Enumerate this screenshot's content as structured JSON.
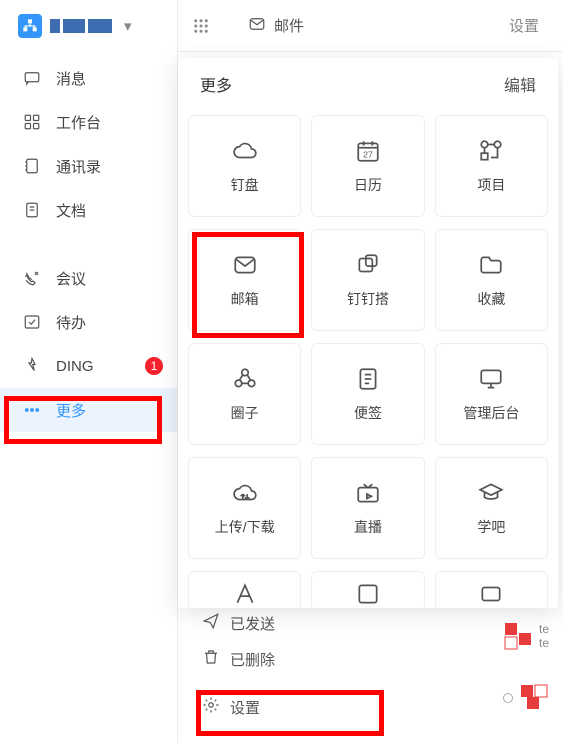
{
  "org": {
    "name_masked": true
  },
  "sidebar": {
    "items": [
      {
        "label": "消息",
        "icon": "chat"
      },
      {
        "label": "工作台",
        "icon": "apps"
      },
      {
        "label": "通讯录",
        "icon": "contacts"
      },
      {
        "label": "文档",
        "icon": "doc"
      }
    ],
    "items2": [
      {
        "label": "会议",
        "icon": "meeting"
      },
      {
        "label": "待办",
        "icon": "todo"
      },
      {
        "label": "DING",
        "icon": "ding",
        "badge": "1"
      }
    ],
    "more_label": "更多"
  },
  "topbar": {
    "mail_label": "邮件",
    "settings_label": "设置"
  },
  "more_panel": {
    "title": "更多",
    "edit": "编辑",
    "tiles": [
      {
        "label": "钉盘",
        "icon": "cloud"
      },
      {
        "label": "日历",
        "icon": "calendar"
      },
      {
        "label": "项目",
        "icon": "project"
      },
      {
        "label": "邮箱",
        "icon": "mail"
      },
      {
        "label": "钉钉搭",
        "icon": "builder"
      },
      {
        "label": "收藏",
        "icon": "folder"
      },
      {
        "label": "圈子",
        "icon": "circle"
      },
      {
        "label": "便签",
        "icon": "note"
      },
      {
        "label": "管理后台",
        "icon": "monitor"
      },
      {
        "label": "上传/下载",
        "icon": "cloud-updown"
      },
      {
        "label": "直播",
        "icon": "live"
      },
      {
        "label": "学吧",
        "icon": "learn"
      }
    ]
  },
  "under": {
    "sent": "已发送",
    "trash": "已删除",
    "settings": "设置",
    "list_te": "te"
  }
}
